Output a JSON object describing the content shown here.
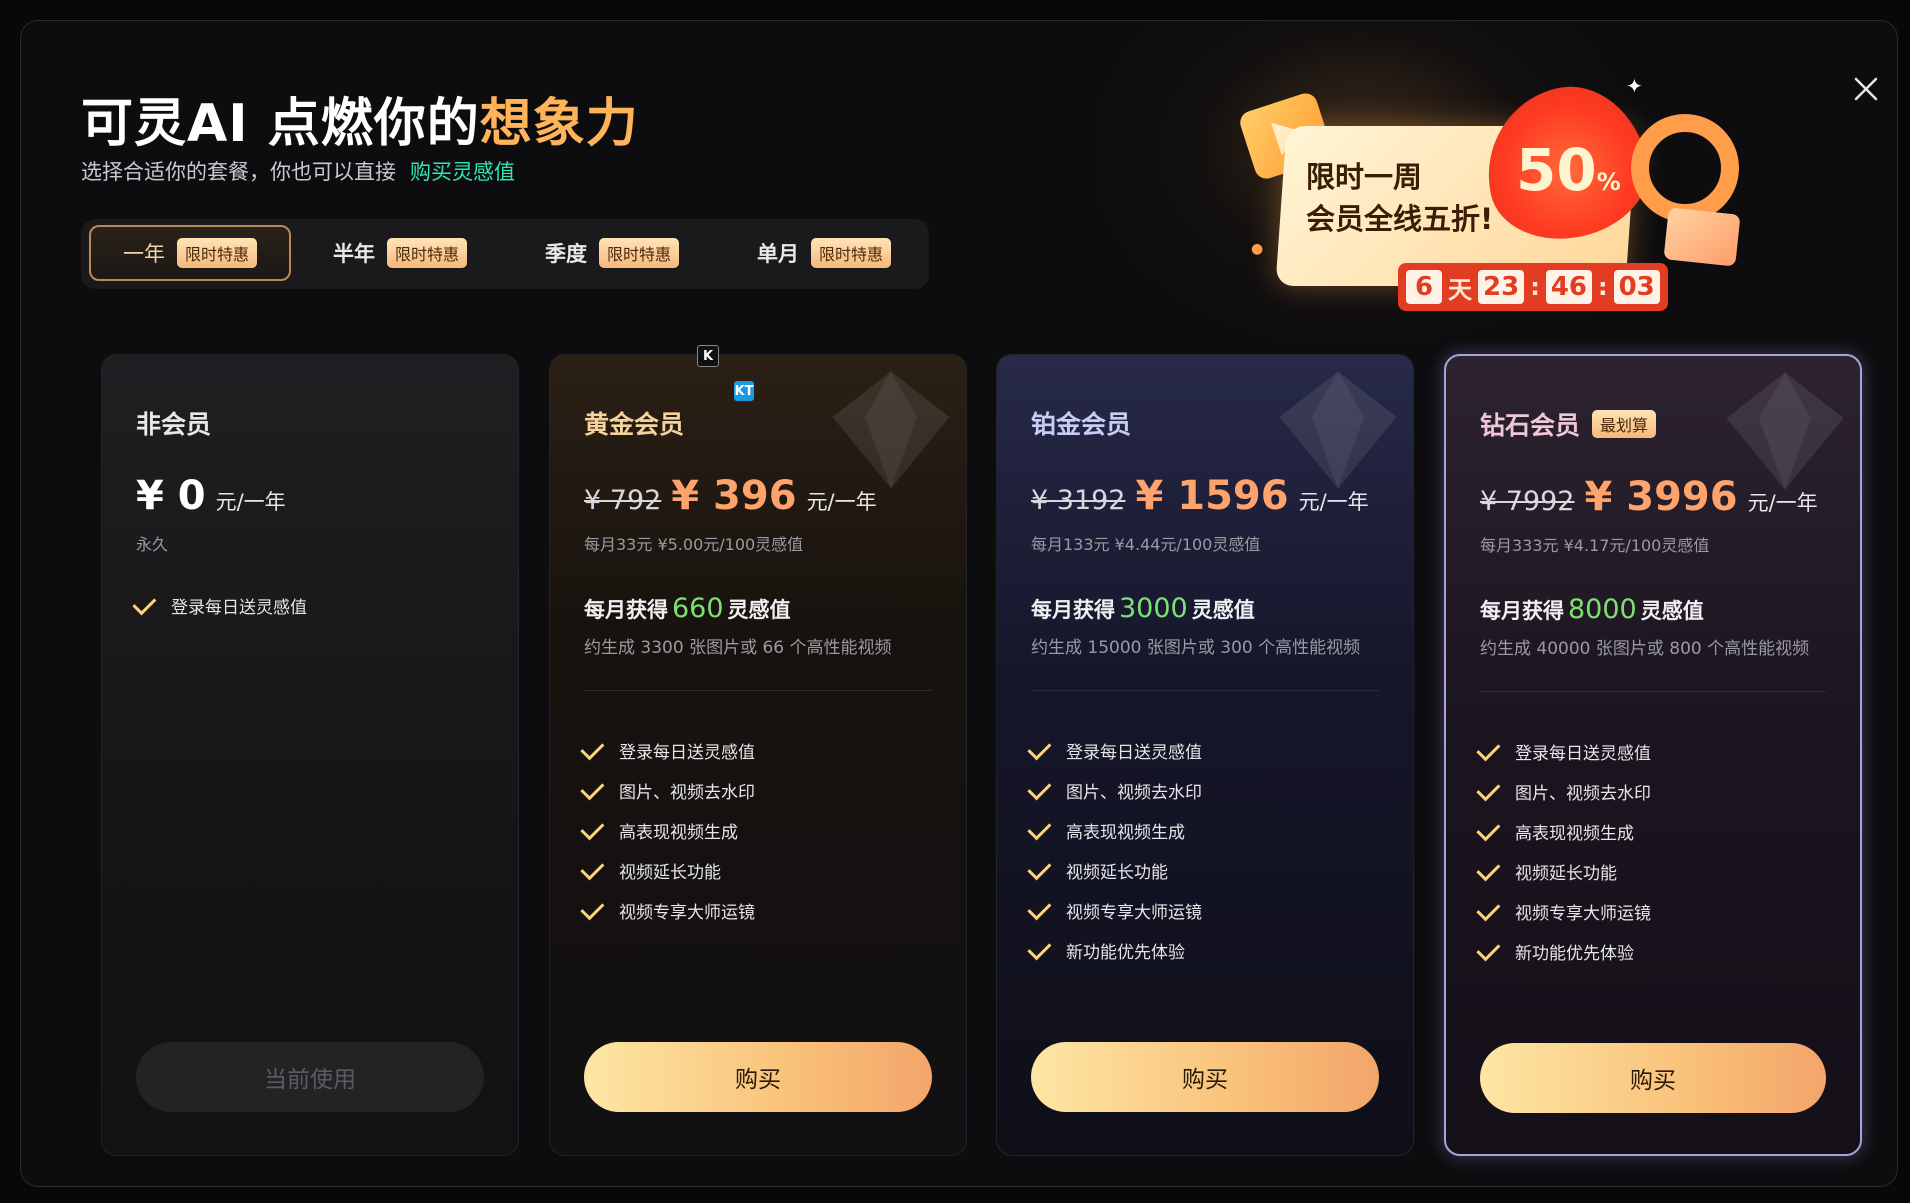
{
  "header": {
    "title_part1": "可灵AI 点燃你的",
    "title_part2": "想象力",
    "subtitle": "选择合适你的套餐，你也可以直接",
    "subtitle_link": "购买灵感值"
  },
  "tabs": [
    {
      "label": "一年",
      "badge": "限时特惠",
      "active": true
    },
    {
      "label": "半年",
      "badge": "限时特惠",
      "active": false
    },
    {
      "label": "季度",
      "badge": "限时特惠",
      "active": false
    },
    {
      "label": "单月",
      "badge": "限时特惠",
      "active": false
    }
  ],
  "promo": {
    "line1": "限时一周",
    "line2": "会员全线五折!",
    "discount": "50",
    "discount_unit": "%",
    "countdown": {
      "days": "6",
      "days_label": "天",
      "hours": "23",
      "minutes": "46",
      "seconds": "03"
    }
  },
  "plans": [
    {
      "name": "非会员",
      "tag": "",
      "original_price": "",
      "price": "¥ 0",
      "unit": "元/一年",
      "price_note": "永久",
      "credits_prefix": "",
      "credits": "",
      "credits_suffix": "",
      "credits_note": "",
      "features": [
        "登录每日送灵感值"
      ],
      "button": "当前使用"
    },
    {
      "name": "黄金会员",
      "tag": "",
      "original_price": "¥ 792",
      "price": "¥ 396",
      "unit": "元/一年",
      "price_note": "每月33元 ¥5.00元/100灵感值",
      "credits_prefix": "每月获得",
      "credits": "660",
      "credits_suffix": "灵感值",
      "credits_note": "约生成 3300 张图片或 66 个高性能视频",
      "features": [
        "登录每日送灵感值",
        "图片、视频去水印",
        "高表现视频生成",
        "视频延长功能",
        "视频专享大师运镜"
      ],
      "button": "购买"
    },
    {
      "name": "铂金会员",
      "tag": "",
      "original_price": "¥ 3192",
      "price": "¥ 1596",
      "unit": "元/一年",
      "price_note": "每月133元 ¥4.44元/100灵感值",
      "credits_prefix": "每月获得",
      "credits": "3000",
      "credits_suffix": "灵感值",
      "credits_note": "约生成 15000 张图片或 300 个高性能视频",
      "features": [
        "登录每日送灵感值",
        "图片、视频去水印",
        "高表现视频生成",
        "视频延长功能",
        "视频专享大师运镜",
        "新功能优先体验"
      ],
      "button": "购买"
    },
    {
      "name": "钻石会员",
      "tag": "最划算",
      "original_price": "¥ 7992",
      "price": "¥ 3996",
      "unit": "元/一年",
      "price_note": "每月333元 ¥4.17元/100灵感值",
      "credits_prefix": "每月获得",
      "credits": "8000",
      "credits_suffix": "灵感值",
      "credits_note": "约生成 40000 张图片或 800 个高性能视频",
      "features": [
        "登录每日送灵感值",
        "图片、视频去水印",
        "高表现视频生成",
        "视频延长功能",
        "视频专享大师运镜",
        "新功能优先体验"
      ],
      "button": "购买"
    }
  ],
  "overlay_icons": {
    "k_label": "K",
    "kt_label": "KT"
  },
  "colors": {
    "accent_orange": "#ffa36c",
    "link_green": "#2fe7b0",
    "credit_green": "#7ee072",
    "button_gold": "#f9c17a"
  }
}
